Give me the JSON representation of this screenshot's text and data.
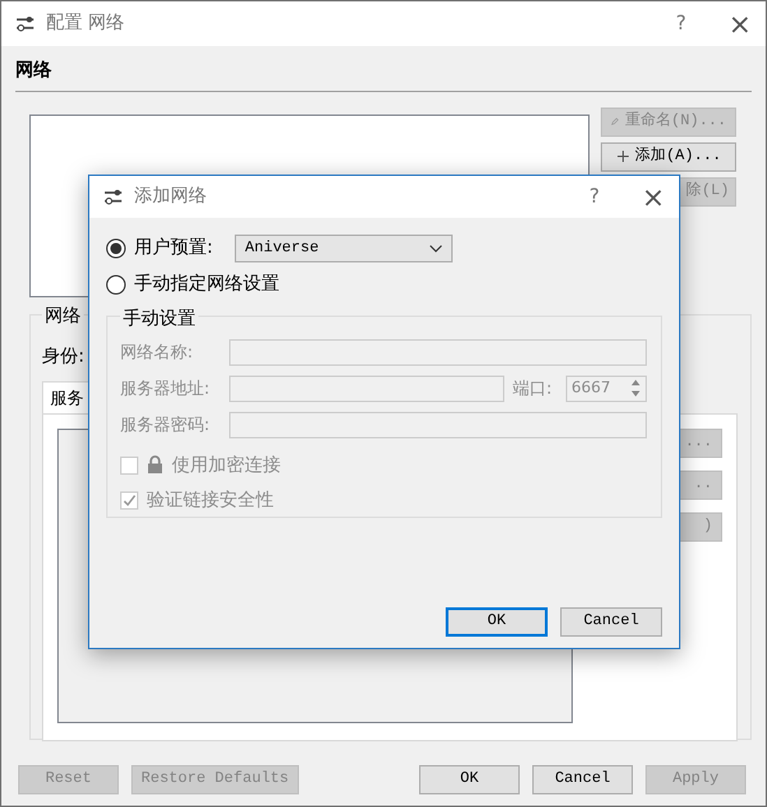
{
  "window": {
    "title": "配置 网络",
    "help": "?",
    "close": "×"
  },
  "section_title": "网络",
  "list_buttons": [
    {
      "label": "重命名(N)...",
      "disabled": true,
      "kind": "pencil"
    },
    {
      "label": "添加(A)...",
      "disabled": false,
      "kind": "plus"
    },
    {
      "label": "除(L)",
      "disabled": true,
      "kind": "plain"
    }
  ],
  "group": {
    "title": "网络",
    "identity_label": "身份:",
    "tabs": [
      {
        "label": "服务",
        "selected": true
      }
    ],
    "side_buttons": [
      "...",
      "..",
      ")"
    ]
  },
  "footer_buttons": [
    {
      "label": "Reset",
      "disabled": true
    },
    {
      "label": "Restore Defaults",
      "disabled": true
    },
    {
      "label": "OK",
      "disabled": false
    },
    {
      "label": "Cancel",
      "disabled": false
    },
    {
      "label": "Apply",
      "disabled": true
    }
  ],
  "dialog": {
    "title": "添加网络",
    "help": "?",
    "close": "×",
    "options": [
      {
        "label": "用户预置:",
        "selected": true
      },
      {
        "label": "手动指定网络设置",
        "selected": false
      }
    ],
    "preset": {
      "value": "Aniverse"
    },
    "manual": {
      "title": "手动设置",
      "disabled": true,
      "fields": [
        {
          "label": "网络名称:"
        },
        {
          "label": "服务器地址:",
          "port_label": "端口:",
          "port_value": "6667"
        },
        {
          "label": "服务器密码:"
        }
      ],
      "checks": [
        {
          "label": "使用加密连接",
          "checked": false,
          "kind": "lock"
        },
        {
          "label": "验证链接安全性",
          "checked": true,
          "kind": "plain"
        }
      ]
    },
    "buttons": [
      {
        "label": "OK",
        "default": true
      },
      {
        "label": "Cancel",
        "default": false
      }
    ]
  }
}
